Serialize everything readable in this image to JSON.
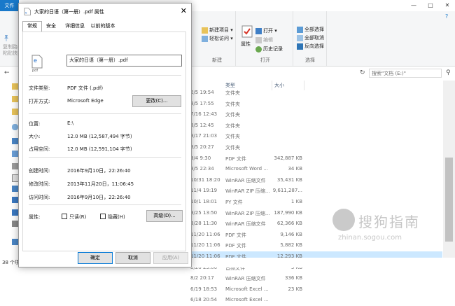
{
  "explorer": {
    "file_tab": "文件",
    "ribbon": {
      "left_items": [
        "复制路径",
        "粘贴快捷方式"
      ],
      "new_group": {
        "label": "新建",
        "new_item": "新建项目",
        "easy_access": "轻松访问"
      },
      "open_group": {
        "label": "打开",
        "properties": "属性",
        "open": "打开",
        "edit": "编辑",
        "history": "历史记录"
      },
      "select_group": {
        "label": "选择",
        "select_all": "全部选择",
        "select_none": "全部取消",
        "invert": "反向选择"
      }
    },
    "search_placeholder": "搜索\"文档 (E:)\"",
    "columns": {
      "type": "类型",
      "size": "大小"
    },
    "rows": [
      {
        "date": "2/5 19:54",
        "type": "文件夹",
        "size": ""
      },
      {
        "date": "8/5 17:55",
        "type": "文件夹",
        "size": ""
      },
      {
        "date": "7/16 12:43",
        "type": "文件夹",
        "size": ""
      },
      {
        "date": "8/5 12:45",
        "type": "文件夹",
        "size": ""
      },
      {
        "date": "8/17 21:03",
        "type": "文件夹",
        "size": ""
      },
      {
        "date": "8/5 20:27",
        "type": "文件夹",
        "size": ""
      },
      {
        "date": "9/4 9:30",
        "type": "PDF 文件",
        "size": "342,887 KB"
      },
      {
        "date": "8/5 22:34",
        "type": "Microsoft Word ...",
        "size": "34 KB"
      },
      {
        "date": "10/31 18:20",
        "type": "WinRAR 压缩文件",
        "size": "35,431 KB"
      },
      {
        "date": "11/4 19:19",
        "type": "WinRAR ZIP 压缩...",
        "size": "9,611,287..."
      },
      {
        "date": "10/1 18:01",
        "type": "PY 文件",
        "size": "1 KB"
      },
      {
        "date": "3/25 13:50",
        "type": "WinRAR ZIP 压缩...",
        "size": "187,990 KB"
      },
      {
        "date": "3/28 11:30",
        "type": "WinRAR 压缩文件",
        "size": "62,366 KB"
      },
      {
        "date": "11/20 11:06",
        "type": "PDF 文件",
        "size": "9,146 KB"
      },
      {
        "date": "11/20 11:06",
        "type": "PDF 文件",
        "size": "5,882 KB"
      },
      {
        "date": "11/20 11:06",
        "type": "PDF 文件",
        "size": "12,293 KB"
      },
      {
        "date": "3/28 23:06",
        "type": "音频文件",
        "size": "3 KB"
      },
      {
        "date": "8/2 20:17",
        "type": "WinRAR 压缩文件",
        "size": "336 KB"
      },
      {
        "date": "6/19 18:53",
        "type": "Microsoft Excel ...",
        "size": "23 KB"
      },
      {
        "date": "6/18 20:54",
        "type": "Microsoft Excel ...",
        "size": ""
      }
    ],
    "status_text": "38 个项目"
  },
  "watermark": {
    "brand": "搜狗指南",
    "url": "zhinan.sogou.com"
  },
  "dialog": {
    "title": "大家的日语（第一册）.pdf 属性",
    "tabs": [
      "常规",
      "安全",
      "详细信息",
      "以前的版本"
    ],
    "file_icon_label": "pdf",
    "filename": "大家的日语（第一册）.pdf",
    "fields": {
      "type_label": "文件类型:",
      "type_value": "PDF 文件 (.pdf)",
      "open_with_label": "打开方式:",
      "open_with_value": "Microsoft Edge",
      "change_button": "更改(C)...",
      "location_label": "位置:",
      "location_value": "E:\\",
      "size_label": "大小:",
      "size_value": "12.0 MB (12,587,494 字节)",
      "disk_label": "占用空间:",
      "disk_value": "12.0 MB (12,591,104 字节)",
      "created_label": "创建时间:",
      "created_value": "2016年9月10日，22:26:40",
      "modified_label": "修改时间:",
      "modified_value": "2013年11月20日，11:06:45",
      "accessed_label": "访问时间:",
      "accessed_value": "2016年9月10日，22:26:40",
      "attr_label": "属性:",
      "readonly_label": "只读(R)",
      "hidden_label": "隐藏(H)",
      "advanced_button": "高级(D)..."
    },
    "buttons": {
      "ok": "确定",
      "cancel": "取消",
      "apply": "应用(A)"
    }
  },
  "colors": {
    "accent": "#1979ca",
    "selected_row": "#cce8ff"
  }
}
